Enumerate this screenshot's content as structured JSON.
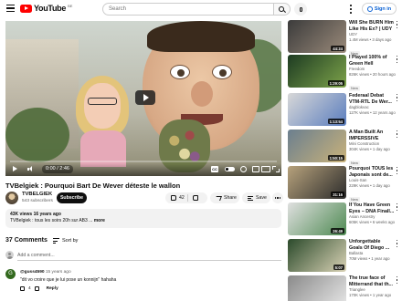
{
  "header": {
    "logo_text": "YouTube",
    "logo_country": "BE",
    "search_placeholder": "Search",
    "signin_label": "Sign in"
  },
  "player": {
    "time": "0:00 / 2:46"
  },
  "video": {
    "title": "TVBelgiek : Pourquoi Bart De Wever déteste le wallon",
    "channel": "TVBELGIEK",
    "subscribers": "543 subscribers",
    "subscribe_label": "Subscribe",
    "likes": "42",
    "share_label": "Share",
    "save_label": "Save",
    "description_meta": "43K views  16 years ago",
    "description_text": "TVBelgiek : tous les soirs 20h sur AB3 ...",
    "description_more": "more"
  },
  "comments": {
    "count_label": "37 Comments",
    "sort_label": "Sort by",
    "add_placeholder": "Add a comment...",
    "items": [
      {
        "avatar_letter": "G",
        "author": "@guss4590",
        "age": "15 years ago",
        "text": "\"dit vo croire que je lui pose un konnijn\" hahaha",
        "likes": "4",
        "reply_label": "Reply"
      }
    ]
  },
  "sidebar": {
    "items": [
      {
        "title": "Will She BURN Him Like His Ex? | UDY ...",
        "channel": "UDY",
        "meta": "1.4M views • 3 days ago",
        "badge": "New",
        "duration": "44:24"
      },
      {
        "title": "I Played 100% of Green Hell",
        "channel": "Freedom",
        "meta": "826K views • 20 hours ago",
        "badge": "New",
        "duration": "1:29:05"
      },
      {
        "title": "Federaal Debat VTM-RTL De Wer...",
        "channel": "dagblokvac",
        "meta": "127K views • 12 years ago",
        "badge": "",
        "duration": "1:13:54"
      },
      {
        "title": "A Man Built An IMPERSSIVE 22,000...",
        "channel": "Mini Construction",
        "meta": "304K views • 1 day ago",
        "badge": "New",
        "duration": "1:50:15"
      },
      {
        "title": "Pourquoi TOUS les Japonais sont de...",
        "channel": "Louis-San",
        "meta": "229K views • 1 day ago",
        "badge": "New",
        "duration": "31:16"
      },
      {
        "title": "If You Have Green Eyes – DNA Finall...",
        "channel": "Asian Ancestry",
        "meta": "605K views • 6 weeks ago",
        "badge": "",
        "duration": "26:49"
      },
      {
        "title": "Unforgettable Goals Of Diego ...",
        "channel": "Ballasta",
        "meta": "70M views • 1 year ago",
        "badge": "",
        "duration": "5:07"
      },
      {
        "title": "The true face of Mitterrand that th...",
        "channel": "Trianglee",
        "meta": "170K views • 1 year ago",
        "badge": "",
        "duration": ""
      }
    ]
  },
  "colors": {
    "brand_red": "#ff0000",
    "link_blue": "#065fd4",
    "comment_avatar_green": "#33691e"
  },
  "icons": [
    "menu-icon",
    "search-icon",
    "mic-icon",
    "more-vert-icon",
    "user-icon",
    "play-icon",
    "volume-icon",
    "captions-icon",
    "autoplay-toggle-icon",
    "settings-gear-icon",
    "miniplayer-icon",
    "theater-icon",
    "fullscreen-icon",
    "thumb-up-icon",
    "thumb-down-icon",
    "share-icon",
    "save-icon",
    "sort-icon"
  ]
}
